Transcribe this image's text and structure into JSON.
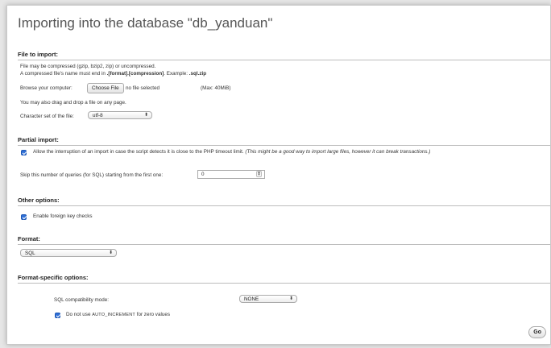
{
  "page_title": "Importing into the database \"db_yanduan\"",
  "file_to_import": {
    "heading": "File to import:",
    "line1": "File may be compressed (gzip, bzip2, zip) or uncompressed.",
    "line2_prefix": "A compressed file's name must end in ",
    "line2_bold": ".[format].[compression]",
    "line2_mid": ". Example: ",
    "line2_example": ".sql.zip",
    "browse_label": "Browse your computer:",
    "choose_file_button": "Choose File",
    "no_file_text": "no file selected",
    "max_size": "(Max: 40MiB)",
    "drag_hint": "You may also drag and drop a file on any page.",
    "charset_label": "Character set of the file:",
    "charset_value": "utf-8"
  },
  "partial_import": {
    "heading": "Partial import:",
    "allow_interrupt_text": "Allow the interruption of an import in case the script detects it is close to the PHP timeout limit.",
    "allow_interrupt_note": "(This might be a good way to import large files, however it can break transactions.)",
    "allow_interrupt_checked": true,
    "skip_label": "Skip this number of queries (for SQL) starting from the first one:",
    "skip_value": "0"
  },
  "other_options": {
    "heading": "Other options:",
    "foreign_key_label": "Enable foreign key checks",
    "foreign_key_checked": true
  },
  "format": {
    "heading": "Format:",
    "value": "SQL"
  },
  "format_specific": {
    "heading": "Format-specific options:",
    "compat_label": "SQL compatibility mode:",
    "compat_value": "NONE",
    "auto_inc_prefix": "Do not use ",
    "auto_inc_keyword": "AUTO_INCREMENT",
    "auto_inc_suffix": " for zero values",
    "auto_inc_checked": true
  },
  "go_button": "Go",
  "colors": {
    "accent": "#2f6fd6",
    "background": "#e6e6e6",
    "panel": "#ffffff"
  }
}
